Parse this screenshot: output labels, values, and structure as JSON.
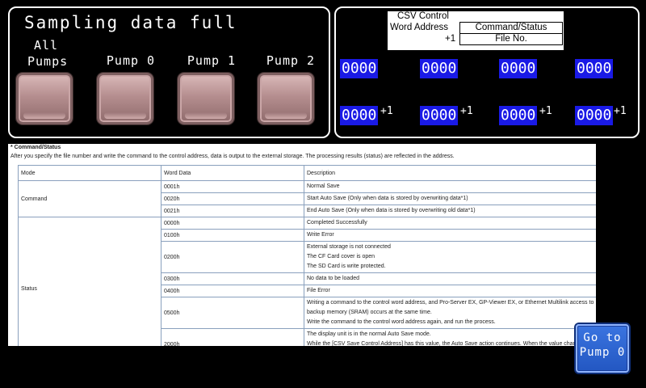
{
  "header": {
    "title": "Sampling data full"
  },
  "pumps": [
    {
      "label": "All\nPumps"
    },
    {
      "label": "Pump 0"
    },
    {
      "label": "Pump 1"
    },
    {
      "label": "Pump 2"
    }
  ],
  "csv_legend": {
    "line1": "CSV Control",
    "line2": "Word Address",
    "plus": "+1",
    "box1": "Command/Status",
    "box2": "File No."
  },
  "values": {
    "row1": [
      "0000",
      "0000",
      "0000",
      "0000"
    ],
    "row2": [
      "0000",
      "0000",
      "0000",
      "0000"
    ],
    "suffix": "+1"
  },
  "doc": {
    "heading": "* Command/Status",
    "intro": "After you specify the file number and write the command to the control address, data is output to the external storage. The processing results (status) are reflected in the address.",
    "columns": [
      "Mode",
      "Word Data",
      "Description"
    ],
    "groups": {
      "command": "Command",
      "status": "Status"
    },
    "rows": [
      {
        "word": "0001h",
        "desc": [
          "Normal Save"
        ]
      },
      {
        "word": "0020h",
        "desc": [
          "Start Auto Save (Only when data is stored by overwriting data*1)"
        ]
      },
      {
        "word": "0021h",
        "desc": [
          "End Auto Save (Only when data is stored by overwriting old data*1)"
        ]
      },
      {
        "word": "0000h",
        "desc": [
          "Completed Successfully"
        ]
      },
      {
        "word": "0100h",
        "desc": [
          "Write Error"
        ]
      },
      {
        "word": "0200h",
        "desc": [
          "External storage is not connected",
          "The CF Card cover is open",
          "The SD Card is write protected."
        ]
      },
      {
        "word": "0300h",
        "desc": [
          "No data to be loaded"
        ]
      },
      {
        "word": "0400h",
        "desc": [
          "File Error"
        ]
      },
      {
        "word": "0500h",
        "desc": [
          "Writing a command to the control word address, and Pro-Server EX, GP-Viewer EX, or Ethernet Multilink access to backup memory (SRAM) occurs at the same time.",
          "Write the command to the control word address again, and run the process."
        ]
      },
      {
        "word": "2000h",
        "desc": [
          "The display unit is in the normal Auto Save mode.",
          "While the [CSV Save Control Address] has this value, the Auto Save action continues. When the value changes, the Auto Save mode finishes."
        ]
      }
    ]
  },
  "goto_button": {
    "label": "Go to\nPump 0"
  }
}
